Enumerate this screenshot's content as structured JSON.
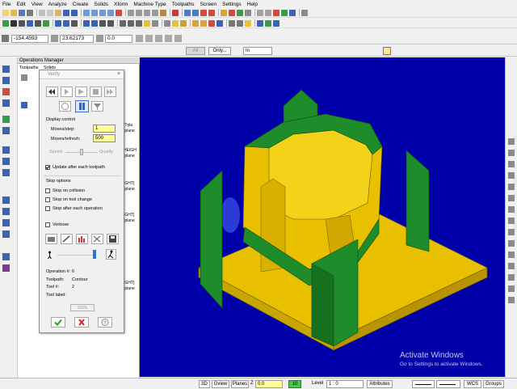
{
  "menu": [
    "File",
    "Edit",
    "View",
    "Analyze",
    "Create",
    "Solids",
    "Xform",
    "Machine Type",
    "Toolpaths",
    "Screen",
    "Settings",
    "Help"
  ],
  "coords": {
    "x": "-154.4593",
    "y": "23.62173",
    "z": "0.0"
  },
  "row4": {
    "all_label": "All",
    "only_label": "Only...",
    "in_label": "In"
  },
  "ops_manager": {
    "title": "Operations Manager",
    "tabs": [
      "Toolpaths",
      "Solids"
    ],
    "side_texts": [
      "[Tpla",
      "[plane",
      "HEIGH",
      "[plane",
      "IGHT]",
      "[plane",
      "IGHT]",
      "[plane",
      "IGHT]",
      "[plane"
    ]
  },
  "verify": {
    "title": "Verify",
    "display_control": "Display control",
    "moves_step_label": "Moves/step:",
    "moves_step_value": "1",
    "moves_refresh_label": "Moves/refresh:",
    "moves_refresh_value": "500",
    "speed_label": "Speed",
    "quality_label": "Quality",
    "update_label": "Update after each toolpath",
    "stop_options": "Stop options",
    "stop_collision": "Stop on collision",
    "stop_tool_change": "Stop on tool change",
    "stop_each_op": "Stop after each operation",
    "verbose": "Verbose",
    "operation_label": "Operation #:",
    "operation_value": "6",
    "toolpath_label": "Toolpath:",
    "toolpath_value": "Contour",
    "tool_label": "Tool #:",
    "tool_value": "2",
    "tool_label_label": "Tool label:",
    "progress_text": "100%",
    "update_checked": true,
    "progress": 1.0
  },
  "watermark": {
    "line1": "Activate Windows",
    "line2": "Go to Settings to activate Windows."
  },
  "bottom": {
    "btn_3d": "3D",
    "btn_gview": "Gview",
    "btn_planes": "Planes",
    "z_label": "Z",
    "z_value": "0.0",
    "level_num": "10",
    "level_label": "Level",
    "level_value": "1 : 0",
    "attributes": "Attributes",
    "wcs": "WCS",
    "groups": "Groups"
  },
  "colors": {
    "viewport_bg": "#0000a8",
    "stock_yellow": "#e8c000",
    "fixture_green": "#1e8c2a",
    "highlight": "#ffff99"
  }
}
